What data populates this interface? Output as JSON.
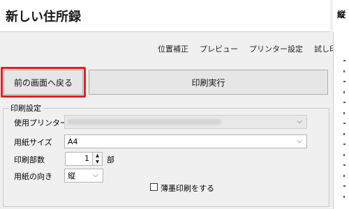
{
  "window": {
    "title": "新しい住所録"
  },
  "menu": [
    "位置補正",
    "プレビュー",
    "プリンター設定",
    "試し印刷"
  ],
  "buttons": {
    "back": "前の画面へ戻る",
    "print": "印刷実行"
  },
  "print_settings": {
    "group_title": "印刷設定",
    "printer_label": "使用プリンター",
    "printer_value": "",
    "paper_size_label": "用紙サイズ",
    "paper_size_value": "A4",
    "copies_label": "印刷部数",
    "copies_value": "1",
    "copies_unit": "部",
    "orientation_label": "用紙の向き",
    "orientation_value": "縦",
    "light_print_label": "薄墨印刷をする",
    "light_print_checked": false
  },
  "right_panel": {
    "title": "縦"
  },
  "colors": {
    "highlight": "#e02020"
  }
}
